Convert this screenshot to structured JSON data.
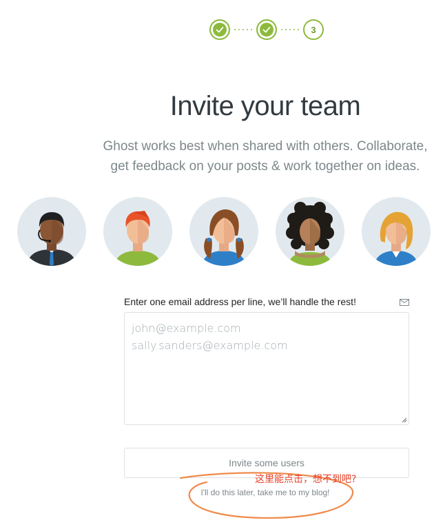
{
  "progress": {
    "steps": [
      {
        "state": "done",
        "icon": "check-icon"
      },
      {
        "state": "done",
        "icon": "check-icon"
      },
      {
        "state": "current",
        "label": "3"
      }
    ],
    "accent_color": "#8dba3d"
  },
  "heading": {
    "title": "Invite your team",
    "subtitle_line1": "Ghost works best when shared with others. Collaborate,",
    "subtitle_line2": "get feedback on your posts & work together on ideas."
  },
  "avatars": [
    {
      "icon": "avatar-man-headset-icon"
    },
    {
      "icon": "avatar-redhead-man-icon"
    },
    {
      "icon": "avatar-brunette-woman-icon"
    },
    {
      "icon": "avatar-curly-hair-woman-icon"
    },
    {
      "icon": "avatar-blonde-woman-icon"
    }
  ],
  "form": {
    "email_label": "Enter one email address per line, we’ll handle the rest!",
    "mail_icon": "envelope-icon",
    "placeholder_line1": "john@example.com",
    "placeholder_line2": "sally.sanders@example.com",
    "invite_button": "Invite some users",
    "skip_link": "I'll do this later, take me to my blog!"
  },
  "annotation": {
    "note": "这里能点击，想不到吧?",
    "color": "#e8412a",
    "scribble_color": "#f08a4b"
  }
}
